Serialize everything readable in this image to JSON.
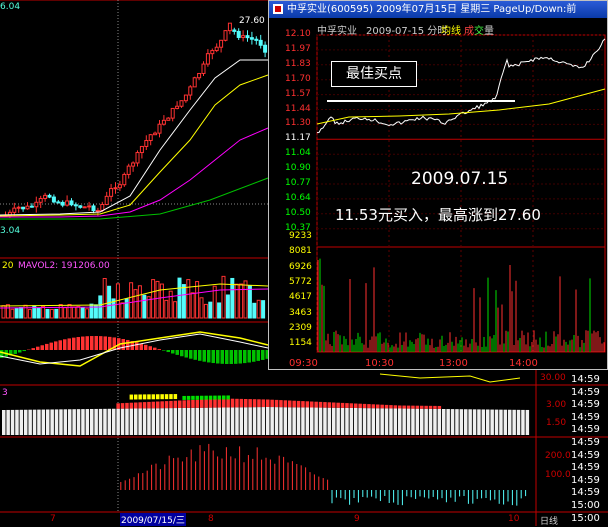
{
  "background": {
    "top_left_value": "6.04",
    "peak_label": "27.60",
    "bottom_left_value": "3.04",
    "mavol_label_a": "20",
    "mavol_label_b": "MAVOL2: 191206.00",
    "macd_marker": "3",
    "date_axis": {
      "d7": "7",
      "highlight": "2009/07/15/三",
      "d8": "8",
      "d9": "9",
      "d10": "10",
      "kline": "日线"
    },
    "right_axis_values": [
      "30.00",
      "3.00",
      "1.50",
      "200.0",
      "100.0"
    ],
    "right_axis_times": [
      "14:59",
      "14:59",
      "14:59",
      "14:59",
      "14:59",
      "14:59",
      "14:59",
      "14:59",
      "14:59",
      "14:59",
      "15:00",
      "15:00"
    ]
  },
  "popup": {
    "title": "中孚实业(600595) 2009年07月15日 星期三 PageUp/Down:前",
    "subheader": {
      "name": "中孚实业",
      "date": "2009-07-15 分时",
      "avg": "均线",
      "vol_a": "成",
      "vol_b": "交",
      "vol_c": "量"
    },
    "price_ticks": [
      "12.10",
      "11.97",
      "11.83",
      "11.70",
      "11.57",
      "11.44",
      "11.30",
      "11.17",
      "11.04",
      "10.90",
      "10.77",
      "10.64",
      "10.50",
      "10.37"
    ],
    "volume_ticks": [
      "9233",
      "8081",
      "6926",
      "5772",
      "4617",
      "3463",
      "2309",
      "1154"
    ],
    "time_ticks": [
      "09:30",
      "10:30",
      "13:00",
      "14:00"
    ],
    "best_buy_label": "最佳买点",
    "annotation_date": "2009.07.15",
    "annotation_text": "11.53元买入，最高涨到27.60"
  },
  "colors": {
    "up": "#ff3232",
    "down": "#54fcfc",
    "ma_yellow": "#ffff00",
    "ma_white": "#ffffff",
    "ma_magenta": "#ff00ff",
    "ma_green": "#00c000",
    "axis_red": "#c00000"
  }
}
